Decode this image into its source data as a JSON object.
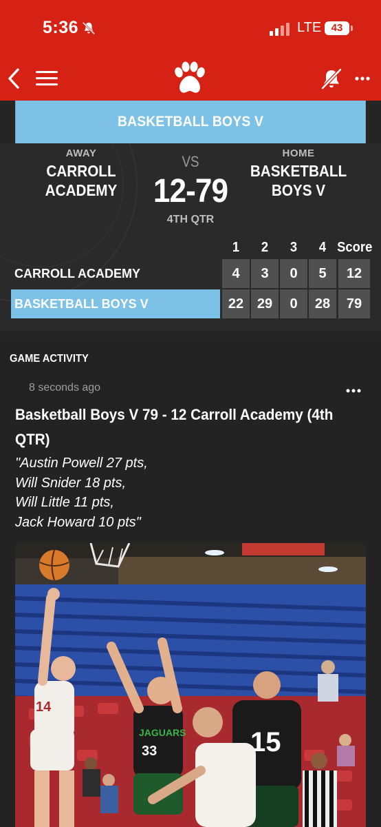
{
  "status_bar": {
    "time": "5:36",
    "network": "LTE",
    "battery": "43"
  },
  "header": {
    "logo_icon": "paw-icon",
    "colors": {
      "brand": "#d62214",
      "accent": "#7dc2e6"
    }
  },
  "sport_title": "BASKETBALL BOYS V",
  "scoreboard": {
    "away_label": "AWAY",
    "away_name": "CARROLL\nACADEMY",
    "vs": "VS",
    "score": "12-79",
    "period": "4TH QTR",
    "home_label": "HOME",
    "home_name": "BASKETBALL\nBOYS V",
    "columns": [
      "1",
      "2",
      "3",
      "4",
      "Score"
    ],
    "rows": [
      {
        "team": "CARROLL ACADEMY",
        "q1": "4",
        "q2": "3",
        "q3": "0",
        "q4": "5",
        "total": "12"
      },
      {
        "team": "BASKETBALL BOYS V",
        "q1": "22",
        "q2": "29",
        "q3": "0",
        "q4": "28",
        "total": "79"
      }
    ]
  },
  "activity": {
    "section_title": "GAME ACTIVITY",
    "post": {
      "time_ago": "8 seconds ago",
      "title": "Basketball Boys V 79 - 12 Carroll Academy (4th QTR)",
      "body": "\"Austin Powell 27 pts,\nWill Snider 18 pts,\nWill Little 11 pts,\nJack Howard 10 pts\"",
      "photo_jersey_numbers": [
        "14",
        "33",
        "15"
      ],
      "photo_jersey_text": "JAGUARS"
    }
  }
}
